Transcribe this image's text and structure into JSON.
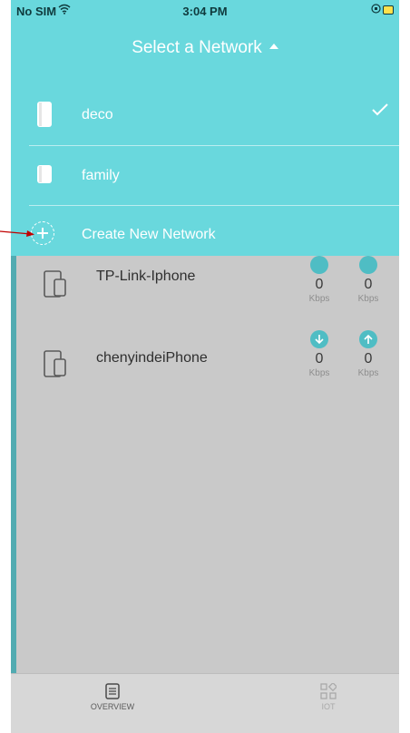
{
  "status_bar": {
    "carrier": "No SIM",
    "time": "3:04 PM"
  },
  "header": {
    "title": "Select a Network"
  },
  "networks": [
    {
      "label": "deco",
      "selected": true,
      "icon": "deco-tall-icon"
    },
    {
      "label": "family",
      "selected": false,
      "icon": "deco-short-icon"
    }
  ],
  "create_network": {
    "label": "Create New Network",
    "icon": "add-circle-icon"
  },
  "devices": [
    {
      "name": "TP-Link-Iphone",
      "icon": "phone-tablet-icon",
      "download": {
        "value": "0",
        "unit": "Kbps"
      },
      "upload": {
        "value": "0",
        "unit": "Kbps"
      }
    },
    {
      "name": "chenyindeiPhone",
      "icon": "phone-tablet-icon",
      "download": {
        "value": "0",
        "unit": "Kbps"
      },
      "upload": {
        "value": "0",
        "unit": "Kbps"
      }
    }
  ],
  "tabbar": {
    "overview_label": "OVERVIEW",
    "iot_label": "IOT"
  },
  "colors": {
    "panel": "#69d8dd",
    "accent": "#4fbdc4",
    "overlay": "#c9c9c9",
    "annotation": "#c00000"
  }
}
